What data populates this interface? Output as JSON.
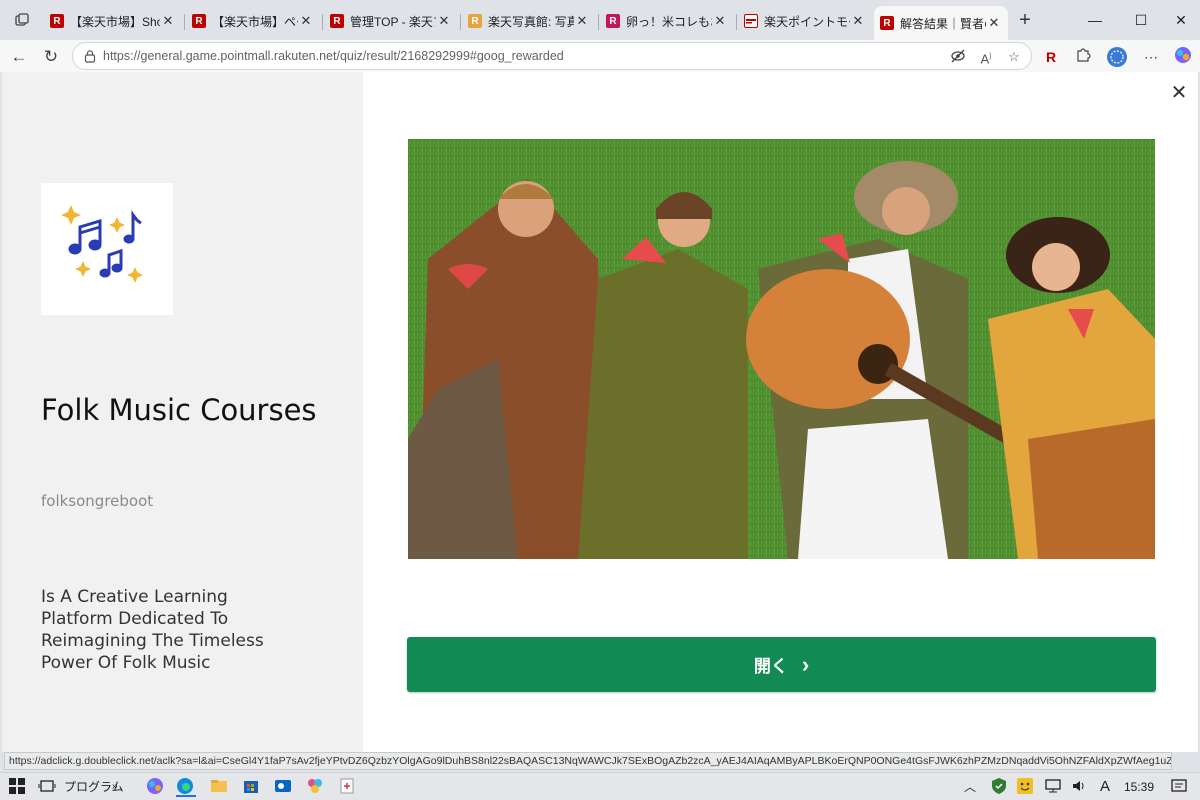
{
  "browser": {
    "tabs": [
      {
        "title": "【楽天市場】Shopping",
        "fav_color": "#bf0000",
        "fav_letter": "R"
      },
      {
        "title": "【楽天市場】ページ",
        "fav_color": "#bf0000",
        "fav_letter": "R"
      },
      {
        "title": "管理TOP - 楽天ブ",
        "fav_color": "#bf0000",
        "fav_letter": "R"
      },
      {
        "title": "楽天写真館: 写真",
        "fav_color": "#e8a33d",
        "fav_letter": "R"
      },
      {
        "title": "卵っ！米コレもお気",
        "fav_color": "#c2185b",
        "fav_letter": "R"
      },
      {
        "title": "楽天ポイントモール",
        "fav_color": "#bf0000",
        "fav_letter": ""
      },
      {
        "title": "解答結果｜賢者の",
        "fav_color": "#bf0000",
        "fav_letter": "R"
      }
    ],
    "active_tab_index": 6,
    "url": "https://general.game.pointmall.rakuten.net/quiz/result/2168292999#goog_rewarded",
    "status_link": "https://adclick.g.doubleclick.net/aclk?sa=l&ai=CseGl4Y1faP7sAv2fjeYPtvDZ6QzbzYOlgAGo9lDuhBS8nl22sBAQASC13NqWAWCJk7SExBOgAZb2zcA_yAEJ4AIAqAMByAPLBKoErQNP0ONGe4tGsFJWK6zhPZMzDNqaddVi5OhNZFAldXpZWfAeg1uZXAwsY..."
  },
  "ad": {
    "title": "Folk Music Courses",
    "handle": "folksongreboot",
    "description": "Is A Creative Learning Platform Dedicated To Reimagining The Timeless Power Of Folk Music",
    "open_button_label": "開く",
    "close_icon": "close-icon",
    "accent_color": "#128a53"
  },
  "taskbar": {
    "program_label": "プログラム",
    "time": "15:39",
    "ime": "A"
  }
}
